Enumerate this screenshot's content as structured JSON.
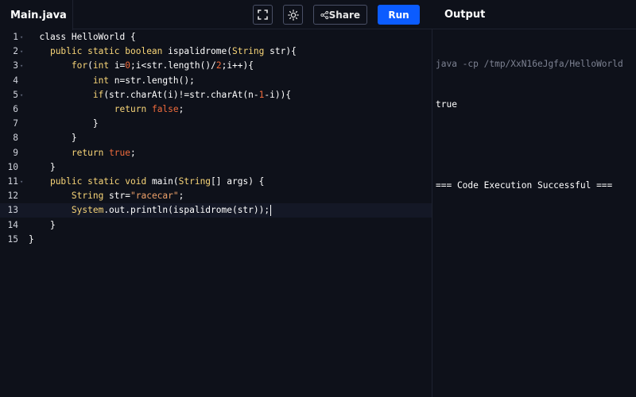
{
  "header": {
    "file_tab": "Main.java",
    "share_label": "Share",
    "run_label": "Run",
    "output_title": "Output"
  },
  "editor": {
    "lines": [
      {
        "num": "1",
        "fold": true,
        "tokens": [
          [
            "plain",
            "  class HelloWorld {"
          ]
        ]
      },
      {
        "num": "2",
        "fold": true,
        "tokens": [
          [
            "plain",
            "    "
          ],
          [
            "kw",
            "public static boolean"
          ],
          [
            "plain",
            " ispalidrome("
          ],
          [
            "type",
            "String"
          ],
          [
            "plain",
            " str){"
          ]
        ]
      },
      {
        "num": "3",
        "fold": true,
        "tokens": [
          [
            "plain",
            "        "
          ],
          [
            "kw",
            "for"
          ],
          [
            "plain",
            "("
          ],
          [
            "type",
            "int"
          ],
          [
            "plain",
            " i="
          ],
          [
            "num",
            "0"
          ],
          [
            "plain",
            ";i<str.length()/"
          ],
          [
            "num",
            "2"
          ],
          [
            "plain",
            ";i++){"
          ]
        ]
      },
      {
        "num": "4",
        "fold": false,
        "tokens": [
          [
            "plain",
            "            "
          ],
          [
            "type",
            "int"
          ],
          [
            "plain",
            " n=str.length();"
          ]
        ]
      },
      {
        "num": "5",
        "fold": true,
        "tokens": [
          [
            "plain",
            "            "
          ],
          [
            "kw",
            "if"
          ],
          [
            "plain",
            "(str.charAt(i)!=str.charAt(n-"
          ],
          [
            "num",
            "1"
          ],
          [
            "plain",
            "-i)){"
          ]
        ]
      },
      {
        "num": "6",
        "fold": false,
        "tokens": [
          [
            "plain",
            "                "
          ],
          [
            "kw",
            "return"
          ],
          [
            "plain",
            " "
          ],
          [
            "lit",
            "false"
          ],
          [
            "plain",
            ";"
          ]
        ]
      },
      {
        "num": "7",
        "fold": false,
        "tokens": [
          [
            "plain",
            "            }"
          ]
        ]
      },
      {
        "num": "8",
        "fold": false,
        "tokens": [
          [
            "plain",
            "        }"
          ]
        ]
      },
      {
        "num": "9",
        "fold": false,
        "tokens": [
          [
            "plain",
            "        "
          ],
          [
            "kw",
            "return"
          ],
          [
            "plain",
            " "
          ],
          [
            "lit",
            "true"
          ],
          [
            "plain",
            ";"
          ]
        ]
      },
      {
        "num": "10",
        "fold": false,
        "tokens": [
          [
            "plain",
            "    }"
          ]
        ]
      },
      {
        "num": "11",
        "fold": true,
        "tokens": [
          [
            "plain",
            "    "
          ],
          [
            "kw",
            "public static void"
          ],
          [
            "plain",
            " main("
          ],
          [
            "type",
            "String"
          ],
          [
            "plain",
            "[] args) {"
          ]
        ]
      },
      {
        "num": "12",
        "fold": false,
        "tokens": [
          [
            "plain",
            "        "
          ],
          [
            "type",
            "String"
          ],
          [
            "plain",
            " str="
          ],
          [
            "str",
            "\"racecar\""
          ],
          [
            "plain",
            ";"
          ]
        ]
      },
      {
        "num": "13",
        "fold": false,
        "active": true,
        "tokens": [
          [
            "plain",
            "        "
          ],
          [
            "type",
            "System"
          ],
          [
            "plain",
            ".out.println(ispalidrome(str));"
          ]
        ]
      },
      {
        "num": "14",
        "fold": false,
        "tokens": [
          [
            "plain",
            "    }"
          ]
        ]
      },
      {
        "num": "15",
        "fold": false,
        "tokens": [
          [
            "plain",
            "}"
          ]
        ]
      }
    ]
  },
  "output": {
    "command": "java -cp /tmp/XxN16eJgfa/HelloWorld",
    "result": "true",
    "status": "=== Code Execution Successful ==="
  },
  "colors": {
    "background": "#0e111a",
    "run_button": "#0b5cff",
    "keyword": "#f8d578",
    "number": "#f06b3c",
    "string": "#f0a36b"
  }
}
